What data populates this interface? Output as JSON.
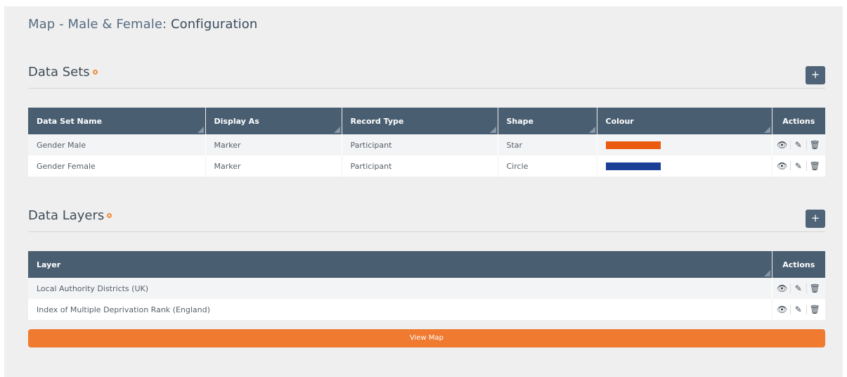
{
  "page": {
    "title_prefix": "Map - Male & Female: ",
    "title_strong": "Configuration"
  },
  "datasets": {
    "heading": "Data Sets",
    "add_label": "+",
    "columns": [
      "Data Set Name",
      "Display As",
      "Record Type",
      "Shape",
      "Colour",
      "Actions"
    ],
    "rows": [
      {
        "name": "Gender Male",
        "display_as": "Marker",
        "record_type": "Participant",
        "shape": "Star",
        "colour": "#ea5a0f"
      },
      {
        "name": "Gender Female",
        "display_as": "Marker",
        "record_type": "Participant",
        "shape": "Circle",
        "colour": "#1b3f97"
      }
    ]
  },
  "layers": {
    "heading": "Data Layers",
    "add_label": "+",
    "columns": [
      "Layer",
      "Actions"
    ],
    "rows": [
      {
        "layer": "Local Authority Districts (UK)"
      },
      {
        "layer": "Index of Multiple Deprivation Rank (England)"
      }
    ]
  },
  "icons": {
    "view": "👁",
    "edit": "✎",
    "delete": "🗑"
  },
  "view_map_label": "View Map",
  "colors": {
    "header": "#4a5e71",
    "accent": "#ef7a30",
    "add_button": "#4f6478"
  }
}
